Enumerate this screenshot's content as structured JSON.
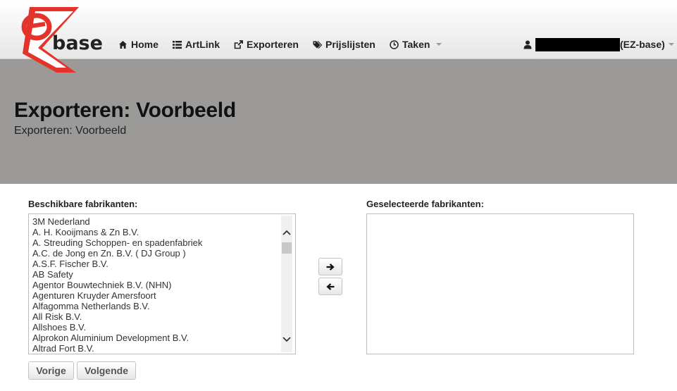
{
  "nav": {
    "logo_text": "base",
    "items": [
      {
        "label": "Home",
        "icon": "home-icon"
      },
      {
        "label": "ArtLink",
        "icon": "list-icon"
      },
      {
        "label": "Exporteren",
        "icon": "export-icon"
      },
      {
        "label": "Prijslijsten",
        "icon": "tags-icon"
      },
      {
        "label": "Taken",
        "icon": "clock-icon"
      }
    ],
    "user": {
      "suffix": "(EZ-base)",
      "icon": "user-icon"
    }
  },
  "header": {
    "title": "Exporteren: Voorbeeld",
    "subtitle": "Exporteren: Voorbeeld"
  },
  "available": {
    "label": "Beschikbare fabrikanten:",
    "items": [
      "3M Nederland",
      "A. H. Kooijmans & Zn B.V.",
      "A. Streuding Schoppen- en spadenfabriek",
      "A.C. de Jong en Zn. B.V. ( DJ Group )",
      "A.S.F. Fischer B.V.",
      "AB Safety",
      "Agentor Bouwtechniek B.V. (NHN)",
      "Agenturen Kruyder Amersfoort",
      "Alfagomma Netherlands B.V.",
      "All Risk B.V.",
      "Allshoes B.V.",
      "Alprokon Aluminium Development B.V.",
      "Altrad Fort B.V."
    ]
  },
  "selected": {
    "label": "Geselecteerde fabrikanten:",
    "items": []
  },
  "buttons": {
    "move_right_icon": "arrow-right-icon",
    "move_left_icon": "arrow-left-icon",
    "previous": "Vorige",
    "next": "Volgende"
  }
}
